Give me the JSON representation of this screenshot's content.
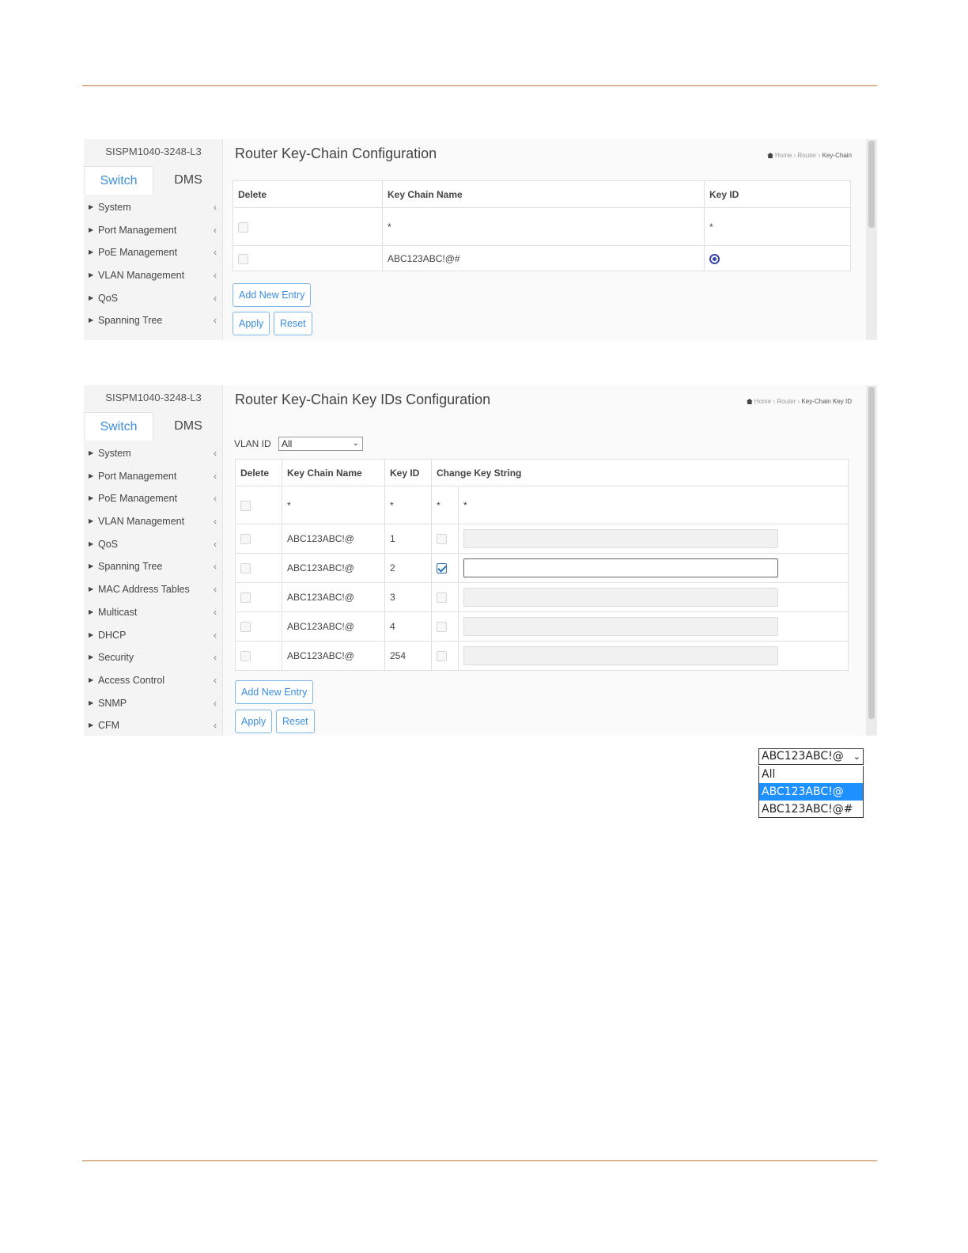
{
  "common": {
    "device_name": "SISPM1040-3248-L3",
    "tab_switch": "Switch",
    "tab_dms": "DMS",
    "breadcrumb_home": "Home",
    "breadcrumb_router": "Router",
    "btn_add_new_entry": "Add New Entry",
    "btn_apply": "Apply",
    "btn_reset": "Reset",
    "wildcard": "*"
  },
  "screen1": {
    "title": "Router Key-Chain Configuration",
    "breadcrumb_current": "Key-Chain",
    "menu": [
      "System",
      "Port Management",
      "PoE Management",
      "VLAN Management",
      "QoS",
      "Spanning Tree"
    ],
    "table": {
      "headers": [
        "Delete",
        "Key Chain Name",
        "Key ID"
      ],
      "rows": [
        {
          "name": "ABC123ABC!@#",
          "key_id_radio_selected": true
        }
      ]
    }
  },
  "screen2": {
    "title": "Router Key-Chain Key IDs Configuration",
    "breadcrumb_current": "Key-Chain Key ID",
    "menu": [
      "System",
      "Port Management",
      "PoE Management",
      "VLAN Management",
      "QoS",
      "Spanning Tree",
      "MAC Address Tables",
      "Multicast",
      "DHCP",
      "Security",
      "Access Control",
      "SNMP",
      "CFM"
    ],
    "vlan_label": "VLAN ID",
    "vlan_value": "All",
    "table": {
      "headers": [
        "Delete",
        "Key Chain Name",
        "Key ID",
        "Change Key String"
      ],
      "rows": [
        {
          "name": "ABC123ABC!@",
          "key_id": "1",
          "change": false
        },
        {
          "name": "ABC123ABC!@",
          "key_id": "2",
          "change": true
        },
        {
          "name": "ABC123ABC!@",
          "key_id": "3",
          "change": false
        },
        {
          "name": "ABC123ABC!@",
          "key_id": "4",
          "change": false
        },
        {
          "name": "ABC123ABC!@",
          "key_id": "254",
          "change": false
        }
      ]
    }
  },
  "dropdown": {
    "selected": "ABC123ABC!@",
    "options": [
      "All",
      "ABC123ABC!@",
      "ABC123ABC!@#"
    ],
    "highlighted_index": 1
  }
}
